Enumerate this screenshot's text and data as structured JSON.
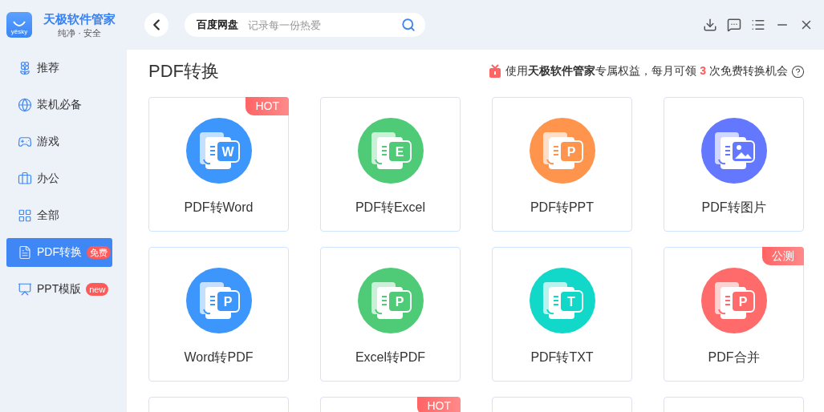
{
  "app": {
    "logo_text": "yësky",
    "name": "天极软件管家",
    "tagline": "纯净 · 安全"
  },
  "search": {
    "label": "百度网盘",
    "placeholder": "记录每一份热爱"
  },
  "sidebar": {
    "items": [
      {
        "label": "推荐",
        "selected": false
      },
      {
        "label": "装机必备",
        "selected": false
      },
      {
        "label": "游戏",
        "selected": false
      },
      {
        "label": "办公",
        "selected": false
      },
      {
        "label": "全部",
        "selected": false
      },
      {
        "label": "PDF转换",
        "selected": true,
        "badge": "免费"
      },
      {
        "label": "PPT模版",
        "selected": false,
        "badge": "new"
      }
    ]
  },
  "page": {
    "title": "PDF转换",
    "promo": [
      {
        "text": "使用",
        "kind": "plain"
      },
      {
        "text": "天极软件管家",
        "kind": "bold"
      },
      {
        "text": "专属权益，每月可领 ",
        "kind": "plain"
      },
      {
        "text": "3",
        "kind": "count"
      },
      {
        "text": " 次免费转换机会",
        "kind": "plain"
      }
    ]
  },
  "tools": [
    {
      "title": "PDF转Word",
      "color": "#3d96fb",
      "glyph": "W",
      "badge": "HOT"
    },
    {
      "title": "PDF转Excel",
      "color": "#4fcb78",
      "glyph": "E"
    },
    {
      "title": "PDF转PPT",
      "color": "#ff944c",
      "glyph": "P"
    },
    {
      "title": "PDF转图片",
      "color": "#6478ff",
      "kind": "image"
    },
    {
      "title": "Word转PDF",
      "color": "#3d96fb",
      "glyph": "P"
    },
    {
      "title": "Excel转PDF",
      "color": "#4fcb78",
      "glyph": "P"
    },
    {
      "title": "PDF转TXT",
      "color": "#11d8c8",
      "glyph": "T"
    },
    {
      "title": "PDF合并",
      "color": "#ff6a6a",
      "glyph": "P",
      "badge": "公测"
    },
    {
      "kind": "empty"
    },
    {
      "kind": "empty",
      "badge": "HOT"
    },
    {
      "kind": "empty"
    },
    {
      "kind": "empty"
    }
  ]
}
